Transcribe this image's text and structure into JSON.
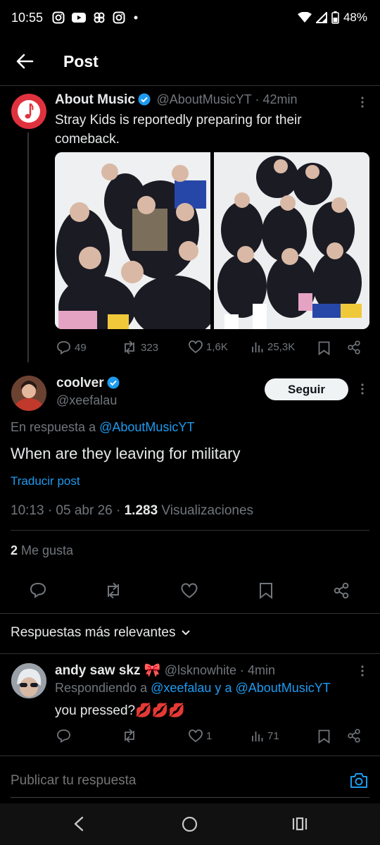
{
  "status": {
    "time": "10:55",
    "battery": "48%"
  },
  "header": {
    "title": "Post"
  },
  "quoted": {
    "name": "About Music",
    "meta": "@AboutMusicYT · 42min",
    "text": "Stray Kids is reportedly preparing for their comeback.",
    "stats": {
      "replies": "49",
      "reposts": "323",
      "likes": "1,6K",
      "views": "25,3K"
    }
  },
  "post": {
    "name": "coolver",
    "handle": "@xeefalau",
    "follow_label": "Seguir",
    "reply_prefix": "En respuesta a ",
    "reply_to": "@AboutMusicYT",
    "text": "When are they leaving for military",
    "translate": "Traducir post",
    "time": "10:13 · 05 abr 26 · ",
    "views_count": "1.283",
    "views_label": " Visualizaciones",
    "likes_count": "2",
    "likes_label": " Me gusta"
  },
  "sort": {
    "label": "Respuestas más relevantes"
  },
  "reply": {
    "name": "andy saw skz",
    "emoji": "🎀",
    "meta": "@lsknowhite · 4min",
    "responding_prefix": "Respondiendo a ",
    "responding_to": "@xeefalau y a @AboutMusicYT",
    "text": "you pressed?",
    "text_emoji": "💋💋💋",
    "stats": {
      "likes": "1",
      "views": "71"
    }
  },
  "composer": {
    "placeholder": "Publicar tu respuesta"
  },
  "colors": {
    "accent": "#1d9bf0",
    "background": "#000000",
    "text": "#e7e9ea",
    "muted": "#71767b",
    "avatar_music": "#e0323e"
  }
}
